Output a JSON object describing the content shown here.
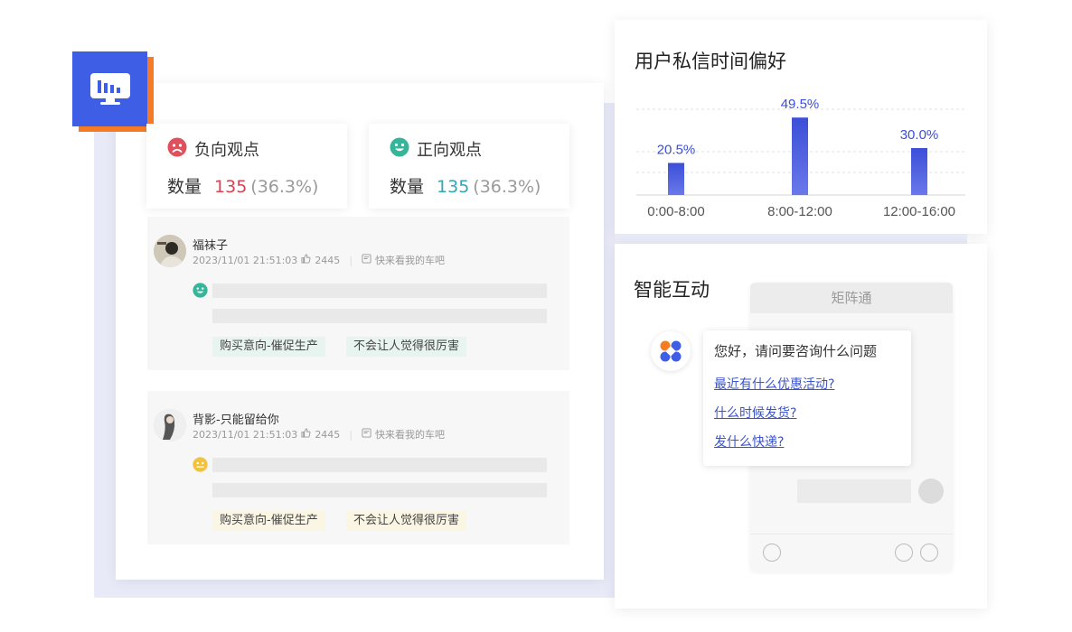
{
  "sentiment": {
    "negative": {
      "title": "负向观点",
      "label": "数量",
      "count": "135",
      "pct": "(36.3%)",
      "color": "#d94351"
    },
    "positive": {
      "title": "正向观点",
      "label": "数量",
      "count": "135",
      "pct": "(36.3%)",
      "color": "#35a6b5"
    }
  },
  "comments": [
    {
      "name": "福袜子",
      "time": "2023/11/01 21:51:03",
      "likes": "2445",
      "source": "快来看我的车吧",
      "mood": "positive",
      "tags": [
        "购买意向-催促生产",
        "不会让人觉得很厉害"
      ]
    },
    {
      "name": "背影-只能留给你",
      "time": "2023/11/01 21:51:03",
      "likes": "2445",
      "source": "快来看我的车吧",
      "mood": "neutral",
      "tags": [
        "购买意向-催促生产",
        "不会让人觉得很厉害"
      ]
    }
  ],
  "chart_data": {
    "type": "bar",
    "title": "用户私信时间偏好",
    "categories": [
      "0:00-8:00",
      "8:00-12:00",
      "12:00-16:00"
    ],
    "values": [
      20.5,
      49.5,
      30.0
    ],
    "value_labels": [
      "20.5%",
      "49.5%",
      "30.0%"
    ],
    "ylim": [
      0,
      60
    ],
    "grid": true,
    "bar_color": "#4455dd"
  },
  "interaction": {
    "title": "智能互动",
    "app_name": "矩阵通",
    "greeting": "您好，请问要咨询什么问题",
    "quick_questions": [
      "最近有什么优惠活动?",
      "什么时候发货?",
      "发什么快递?"
    ]
  }
}
